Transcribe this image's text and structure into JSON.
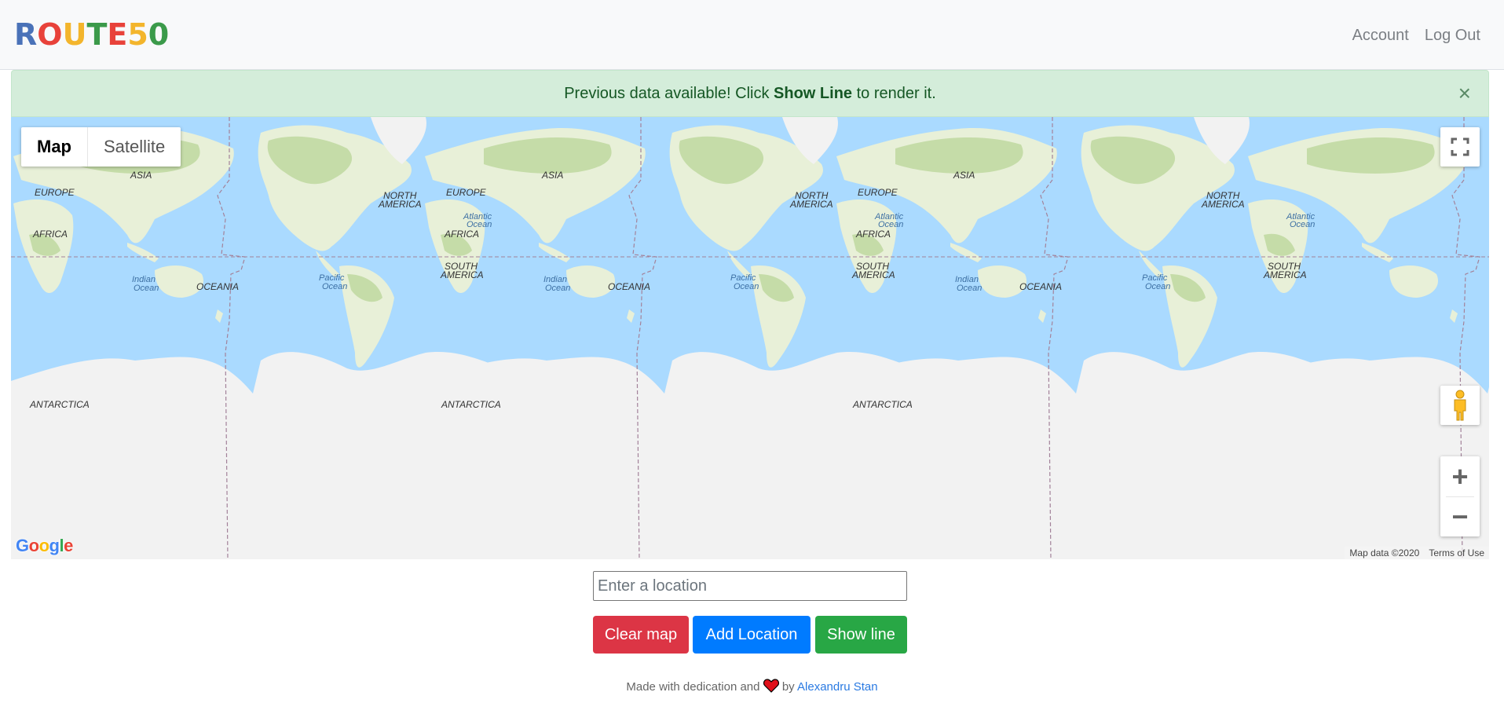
{
  "brand": {
    "letters": [
      "R",
      "O",
      "U",
      "T",
      "E",
      "5",
      "0"
    ],
    "colors": [
      "#4a72b8",
      "#e8423a",
      "#f3b52c",
      "#3b9a4a",
      "#e8423a",
      "#f3b52c",
      "#3b9a4a"
    ]
  },
  "nav": {
    "account": "Account",
    "logout": "Log Out"
  },
  "alert": {
    "text_before": "Previous data available! Click",
    "bold": "Show Line",
    "text_after": "to render it.",
    "close": "×"
  },
  "map": {
    "type_map": "Map",
    "type_satellite": "Satellite",
    "attribution": "Map data ©2020",
    "terms": "Terms of Use",
    "google_letters": [
      "G",
      "o",
      "o",
      "g",
      "l",
      "e"
    ],
    "google_colors": [
      "#4285f4",
      "#ea4335",
      "#fbbc05",
      "#4285f4",
      "#34a853",
      "#ea4335"
    ],
    "zoom_in": "+",
    "zoom_out": "−",
    "labels": {
      "europe": "EUROPE",
      "asia": "ASIA",
      "africa": "AFRICA",
      "north_america": [
        "NORTH",
        "AMERICA"
      ],
      "south_america": [
        "SOUTH",
        "AMERICA"
      ],
      "oceania": "OCEANIA",
      "antarctica": "ANTARCTICA",
      "atlantic": [
        "Atlantic",
        "Ocean"
      ],
      "indian": [
        "Indian",
        "Ocean"
      ],
      "pacific": [
        "Pacific",
        "Ocean"
      ]
    },
    "colors": {
      "water": "#aadaff",
      "land": "#e8f0d8",
      "forest": "#c5dca8",
      "ice": "#f2f2f2"
    }
  },
  "form": {
    "placeholder": "Enter a location",
    "clear": "Clear map",
    "add": "Add Location",
    "show": "Show line"
  },
  "footer": {
    "before": "Made with dedication and",
    "by": "by",
    "author": "Alexandru Stan"
  }
}
